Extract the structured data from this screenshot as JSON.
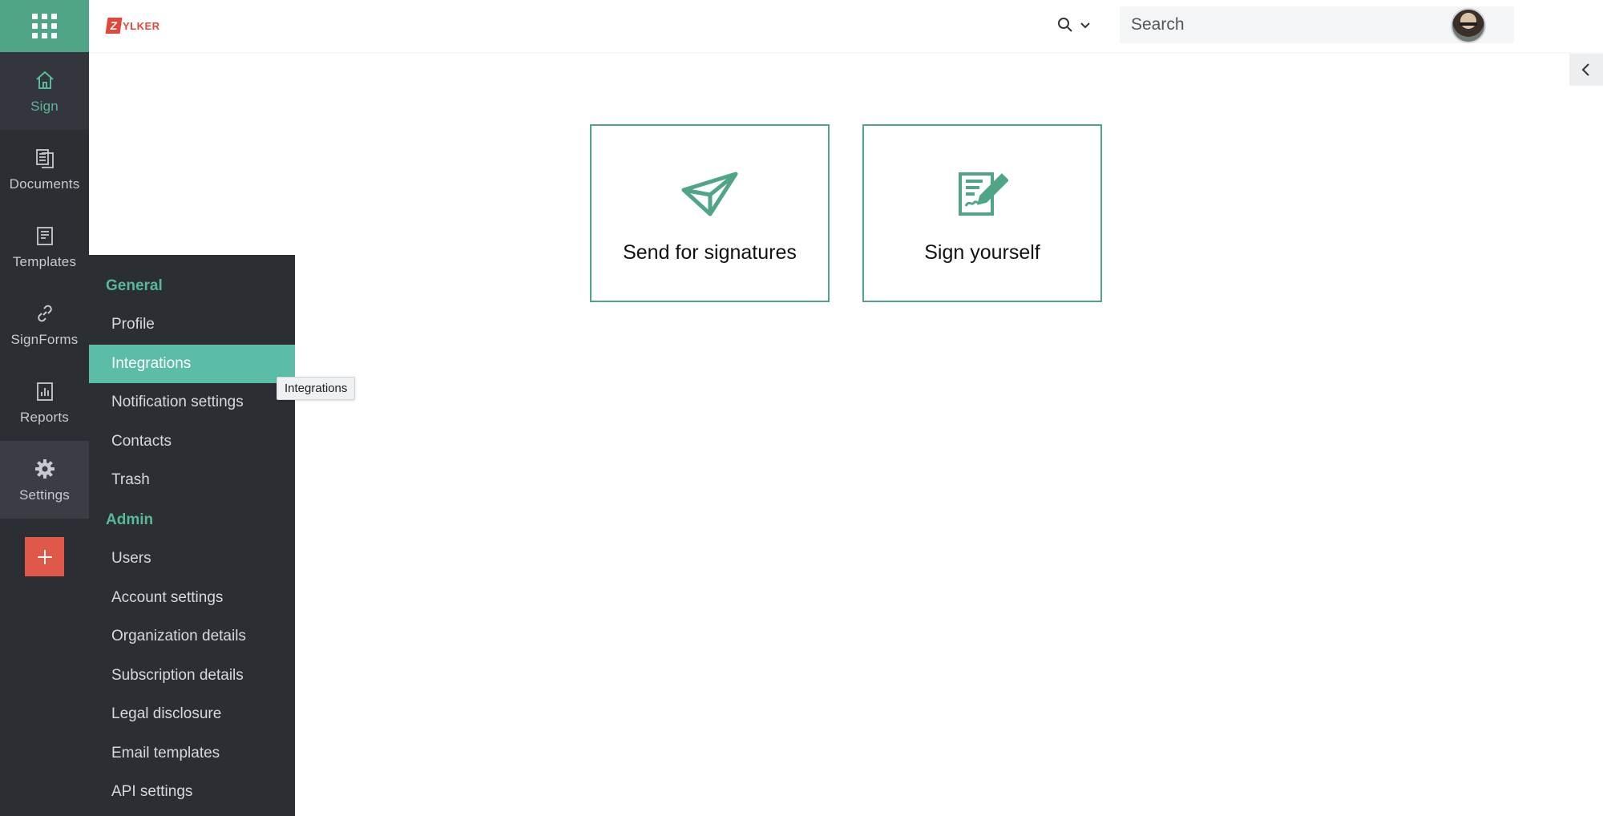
{
  "brand": {
    "logo_letter": "Z",
    "logo_word": "YLKER",
    "accent": "#4fa585",
    "logo_color": "#e0473d"
  },
  "rail": {
    "items": [
      {
        "label": "Sign",
        "icon": "home-icon"
      },
      {
        "label": "Documents",
        "icon": "documents-icon"
      },
      {
        "label": "Templates",
        "icon": "templates-icon"
      },
      {
        "label": "SignForms",
        "icon": "link-icon"
      },
      {
        "label": "Reports",
        "icon": "reports-icon"
      },
      {
        "label": "Settings",
        "icon": "gear-icon"
      }
    ],
    "add_icon": "plus-icon"
  },
  "header": {
    "search_placeholder": "Search",
    "search_scope_icon": "search-icon"
  },
  "settings_menu": {
    "general_heading": "General",
    "general_items": [
      "Profile",
      "Integrations",
      "Notification settings",
      "Contacts",
      "Trash"
    ],
    "admin_heading": "Admin",
    "admin_items": [
      "Users",
      "Account settings",
      "Organization details",
      "Subscription details",
      "Legal disclosure",
      "Email templates",
      "API settings"
    ],
    "selected": "Integrations"
  },
  "tooltip": {
    "text": "Integrations"
  },
  "actions": {
    "send_label": "Send for signatures",
    "sign_label": "Sign yourself"
  }
}
